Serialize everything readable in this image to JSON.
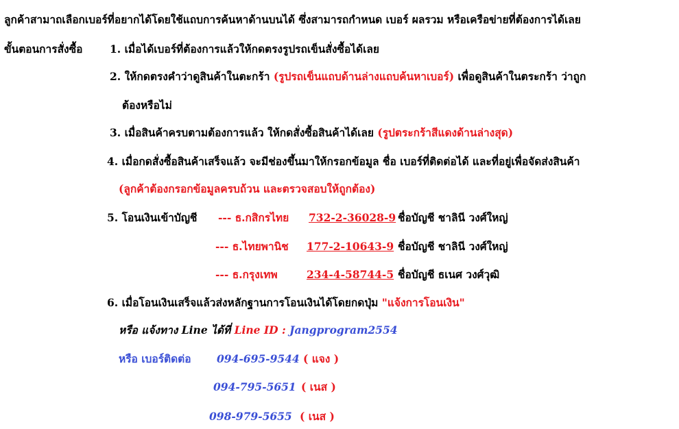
{
  "intro": "ลูกค้าสามาถเลือกเบอร์ที่อยากได้โดยใช้แถบการค้นหาด้านบนได้ ซึ่งสามารถกำหนด เบอร์ ผลรวม หรือเครือข่ายที่ต้องการได้เลย",
  "heading": "ขั้นตอนการสั่งซื้อ",
  "steps": {
    "s1": "1. เมื่อได้เบอร์ที่ต้องการแล้วให้กดตรงรูปรถเข็นสั่งซื้อได้เลย",
    "s2_prefix": "2. ให้กดตรงคำว่าดูสินค้าในตะกร้า",
    "s2_note": "(รูปรถเข็นแถบด้านล่างแถบค้นหาเบอร์)",
    "s2_suffix": "เพื่อดูสินค้าในตระกร้า ว่าถูก",
    "s2_cont": "ต้องหรือไม่",
    "s3_prefix": "3. เมื่อสินค้าครบตามต้องการแล้ว ให้กดสั่งซื้อสินค้าได้เลย",
    "s3_note": "(รูปตระกร้าสีแดงด้านล่างสุด)",
    "s4": "4. เมื่อกดสั่งซื้อสินค้าเสร็จแล้ว จะมีช่องขึ้นมาให้กรอกข้อมูล ชื่อ เบอร์ที่ติดต่อได้ และที่อยู่เพื่อจัดส่งสินค้า",
    "s4_note": "(ลูกค้าต้องกรอกข้อมูลครบถ้วน และตรวจสอบให้ถูกต้อง)",
    "s5_label": "5. โอนเงินเข้าบัญชี",
    "s6_prefix": "6. เมื่อโอนเงินเสร็จแล้วส่งหลักฐานการโอนเงินได้โดยกดปุ่ม",
    "s6_button": "\"แจ้งการโอนเงิน\""
  },
  "banks": [
    {
      "bank": "--- ธ.กสิกรไทย",
      "account": "732-2-36028-9",
      "name": "ชื่อบัญชี  ชาลินี วงศ์ใหญ่"
    },
    {
      "bank": "--- ธ.ไทยพานิช",
      "account": "177-2-10643-9",
      "name": "ชื่อบัญชี  ชาลินี วงศ์ใหญ่"
    },
    {
      "bank": "--- ธ.กรุงเทพ",
      "account": "234-4-58744-5",
      "name": "ชื่อบัญชี  ธเนศ วงศ์วุฒิ"
    }
  ],
  "contact": {
    "line_prefix": "หรือ แจ้งทาง Line ได้ที่",
    "line_label": "Line ID :",
    "line_id": "Jangprogram2554",
    "phone_label": "หรือ เบอร์ติดต่อ",
    "phones": [
      {
        "number": "094-695-9544",
        "who": "( แจง )"
      },
      {
        "number": "094-795-5651",
        "who": "( เนส )"
      },
      {
        "number": "098-979-5655",
        "who": "( เนส )"
      }
    ]
  },
  "colors": {
    "red": "#e8191f",
    "blue": "#3a4fd6",
    "text": "#000000"
  }
}
